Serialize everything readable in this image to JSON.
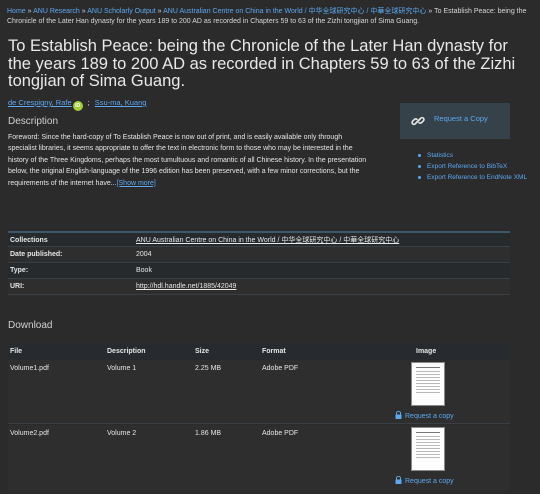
{
  "breadcrumb": {
    "items": [
      "Home",
      "ANU Research",
      "ANU Scholarly Output",
      "ANU Australian Centre on China in the World / 中华全球研究中心 / 中華全球研究中心"
    ],
    "separator": "»",
    "current": "To Establish Peace: being the Chronicle of the Later Han dynasty for the years 189 to 200 AD as recorded in Chapters 59 to 63 of the Zizhi tongjian of Sima Guang."
  },
  "title": "To Establish Peace: being the Chronicle of the Later Han dynasty for the years 189 to 200 AD as recorded in Chapters 59 to 63 of the Zizhi tongjian of Sima Guang.",
  "authors": {
    "first": "de Crespigny, Rafe",
    "orcid_badge": "iD",
    "separator": ";",
    "second": "Ssu-ma, Kuang"
  },
  "description": {
    "heading": "Description",
    "text": "Foreword: Since the hard-copy of To Establish Peace is now out of print, and is easily available only through specialist libraries, it seems appropriate to offer the text in electronic form to those who may be interested in the history of the Three Kingdoms, perhaps the most tumultuous and romantic of all Chinese history. In the presentation below, the original English-language of the 1996 edition has been preserved, with a few minor corrections, but the requirements of the internet have...",
    "show_more": "[Show more]"
  },
  "sidebar": {
    "request_copy": "Request a Copy",
    "links": [
      "Statistics",
      "Export Reference to BibTeX",
      "Export Reference to EndNote XML"
    ]
  },
  "metadata": {
    "rows": [
      {
        "key": "Collections",
        "value": "ANU Australian Centre on China in the World / 中华全球研究中心 / 中華全球研究中心",
        "link": true
      },
      {
        "key": "Date published:",
        "value": "2004",
        "link": false
      },
      {
        "key": "Type:",
        "value": "Book",
        "link": false
      },
      {
        "key": "URI:",
        "value": "http://hdl.handle.net/1885/42049",
        "link": true
      }
    ]
  },
  "download": {
    "heading": "Download",
    "columns": {
      "file": "File",
      "description": "Description",
      "size": "Size",
      "format": "Format",
      "image": "Image"
    },
    "files": [
      {
        "file": "Volume1.pdf",
        "description": "Volume 1",
        "size": "2.25 MB",
        "format": "Adobe PDF",
        "request": "Request a copy"
      },
      {
        "file": "Volume2.pdf",
        "description": "Volume 2",
        "size": "1.86 MB",
        "format": "Adobe PDF",
        "request": "Request a copy"
      }
    ]
  },
  "colors": {
    "background": "#2b2b2b",
    "link": "#5ca8f0",
    "sidebar_box": "#36424a",
    "orcid": "#a6ce39"
  },
  "icons": {
    "request_copy": "link-chain-icon",
    "file_request": "lock-icon",
    "list_bullet": "bullet-icon"
  }
}
